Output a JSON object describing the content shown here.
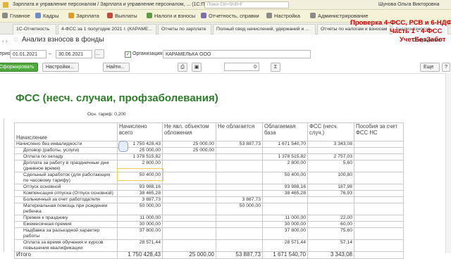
{
  "titlebar": {
    "title": "Зарплата и управление персоналом / Зарплата и управление персоналом, ... (1С:Предприятие)",
    "search_placeholder": "Поиск Ctrl+Shift+F",
    "user": "Шунова Ольга Викторовна"
  },
  "menu": [
    "Главное",
    "Кадры",
    "Зарплата",
    "Выплаты",
    "Налоги и взносы",
    "Отчетность, справки",
    "Настройка",
    "Администрирование"
  ],
  "tabs": [
    "1С-Отчетность",
    "4-ФСС за 1 полугодие 2021 г. (КАРАМЕ...",
    "Отчеты по зарплате",
    "Полный свод начислений, удержаний и ...",
    "Отчеты по налогам и взносам",
    "Анализ взносов..."
  ],
  "overlay": [
    "Проверка 4-ФСС, РСВ и 6-НДФЛ",
    "Часть 1 - 4-ФСС",
    "УчетБезЗабот"
  ],
  "document": {
    "title": "Анализ взносов в фонды",
    "discuss": "Обсуждение",
    "period_label": "Период:",
    "date_from": "01.01.2021",
    "dash": "–",
    "date_to": "30.06.2021",
    "org_label": "Организация:",
    "org": "КАРАМЕЛЬКА ООО"
  },
  "toolbar": {
    "form": "Сформировать",
    "settings": "Настройки...",
    "find": "Найти...",
    "zoom": "0",
    "sigma": "Σ",
    "more": "Еще",
    "help": "?"
  },
  "report": {
    "title": "ФСС (несч. случаи, профзаболевания)",
    "tarif": "Осн. тариф: 0,200",
    "headers": [
      "Начисление",
      "Начислено всего",
      "Не явл. объектом обложения",
      "Не облагается",
      "Облагаемая база",
      "ФСС (несч. случ.)",
      "Пособия за счет ФСС НС"
    ],
    "rows": [
      [
        "Начислено без инвалидности",
        "1 750 428,43",
        "25 000,00",
        "53 887,73",
        "1 671 540,70",
        "3 343,08",
        ""
      ],
      [
        "Договор (работы, услуги)",
        "25 000,00",
        "25 000,00",
        "",
        "",
        "",
        ""
      ],
      [
        "Оплата по окладу",
        "1 378 515,82",
        "",
        "",
        "1 378 515,82",
        "2 757,03",
        ""
      ],
      [
        "Доплата за работу в праздничные дни (дневное время)",
        "2 800,00",
        "",
        "",
        "2 800,00",
        "5,60",
        ""
      ],
      [
        "Сдельный заработок (для работающих по часовому тарифу)",
        "50 400,00",
        "",
        "",
        "50 400,00",
        "100,80",
        ""
      ],
      [
        "Отпуск основной",
        "93 988,16",
        "",
        "",
        "93 988,16",
        "187,98",
        ""
      ],
      [
        "Компенсация отпуска (Отпуск основной)",
        "38 465,28",
        "",
        "",
        "38 465,28",
        "76,93",
        ""
      ],
      [
        "Больничный за счет работодателя",
        "3 887,73",
        "",
        "3 887,73",
        "",
        "",
        ""
      ],
      [
        "Материальная помощь при рождении ребенка",
        "50 000,00",
        "",
        "50 000,00",
        "",
        "",
        ""
      ],
      [
        "Премия к празднику",
        "11 000,00",
        "",
        "",
        "11 000,00",
        "22,00",
        ""
      ],
      [
        "Ежемесячная премия",
        "30 000,00",
        "",
        "",
        "30 000,00",
        "60,00",
        ""
      ],
      [
        "Надбавка за разъездной характер работы",
        "37 800,00",
        "",
        "",
        "37 800,00",
        "75,60",
        ""
      ],
      [
        "Оплата за время обучения и курсов повышения квалификации",
        "28 571,44",
        "",
        "",
        "28 571,44",
        "57,14",
        ""
      ]
    ],
    "total": [
      "Итого",
      "1 750 428,43",
      "25 000,00",
      "53 887,73",
      "1 671 540,70",
      "3 343,08",
      ""
    ]
  }
}
